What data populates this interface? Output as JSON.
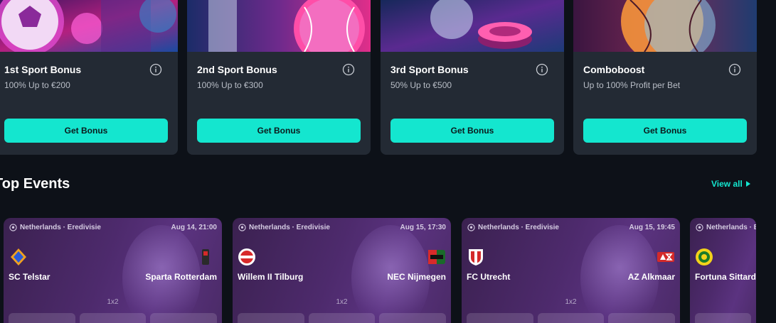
{
  "colors": {
    "accent": "#14e6cf",
    "card": "#232a34",
    "background": "#0d1118"
  },
  "bonuses": [
    {
      "title": "1st Sport Bonus",
      "subtitle": "100% Up to €200",
      "button": "Get Bonus"
    },
    {
      "title": "2nd Sport Bonus",
      "subtitle": "100% Up to €300",
      "button": "Get Bonus"
    },
    {
      "title": "3rd Sport Bonus",
      "subtitle": "50% Up to €500",
      "button": "Get Bonus"
    },
    {
      "title": "Comboboost",
      "subtitle": "Up to 100% Profit per Bet",
      "button": "Get Bonus"
    }
  ],
  "top_events": {
    "title": "Top Events",
    "view_all": "View all",
    "events": [
      {
        "league": "Netherlands · Eredivisie",
        "date": "Aug 14, 21:00",
        "home": "SC Telstar",
        "away": "Sparta Rotterdam",
        "market": "1x2"
      },
      {
        "league": "Netherlands · Eredivisie",
        "date": "Aug 15, 17:30",
        "home": "Willem II Tilburg",
        "away": "NEC Nijmegen",
        "market": "1x2"
      },
      {
        "league": "Netherlands · Eredivisie",
        "date": "Aug 15, 19:45",
        "home": "FC Utrecht",
        "away": "AZ Alkmaar",
        "market": "1x2"
      },
      {
        "league": "Netherlands · Eredivisie",
        "date": "",
        "home": "Fortuna Sittard",
        "away": "",
        "market": ""
      }
    ]
  }
}
